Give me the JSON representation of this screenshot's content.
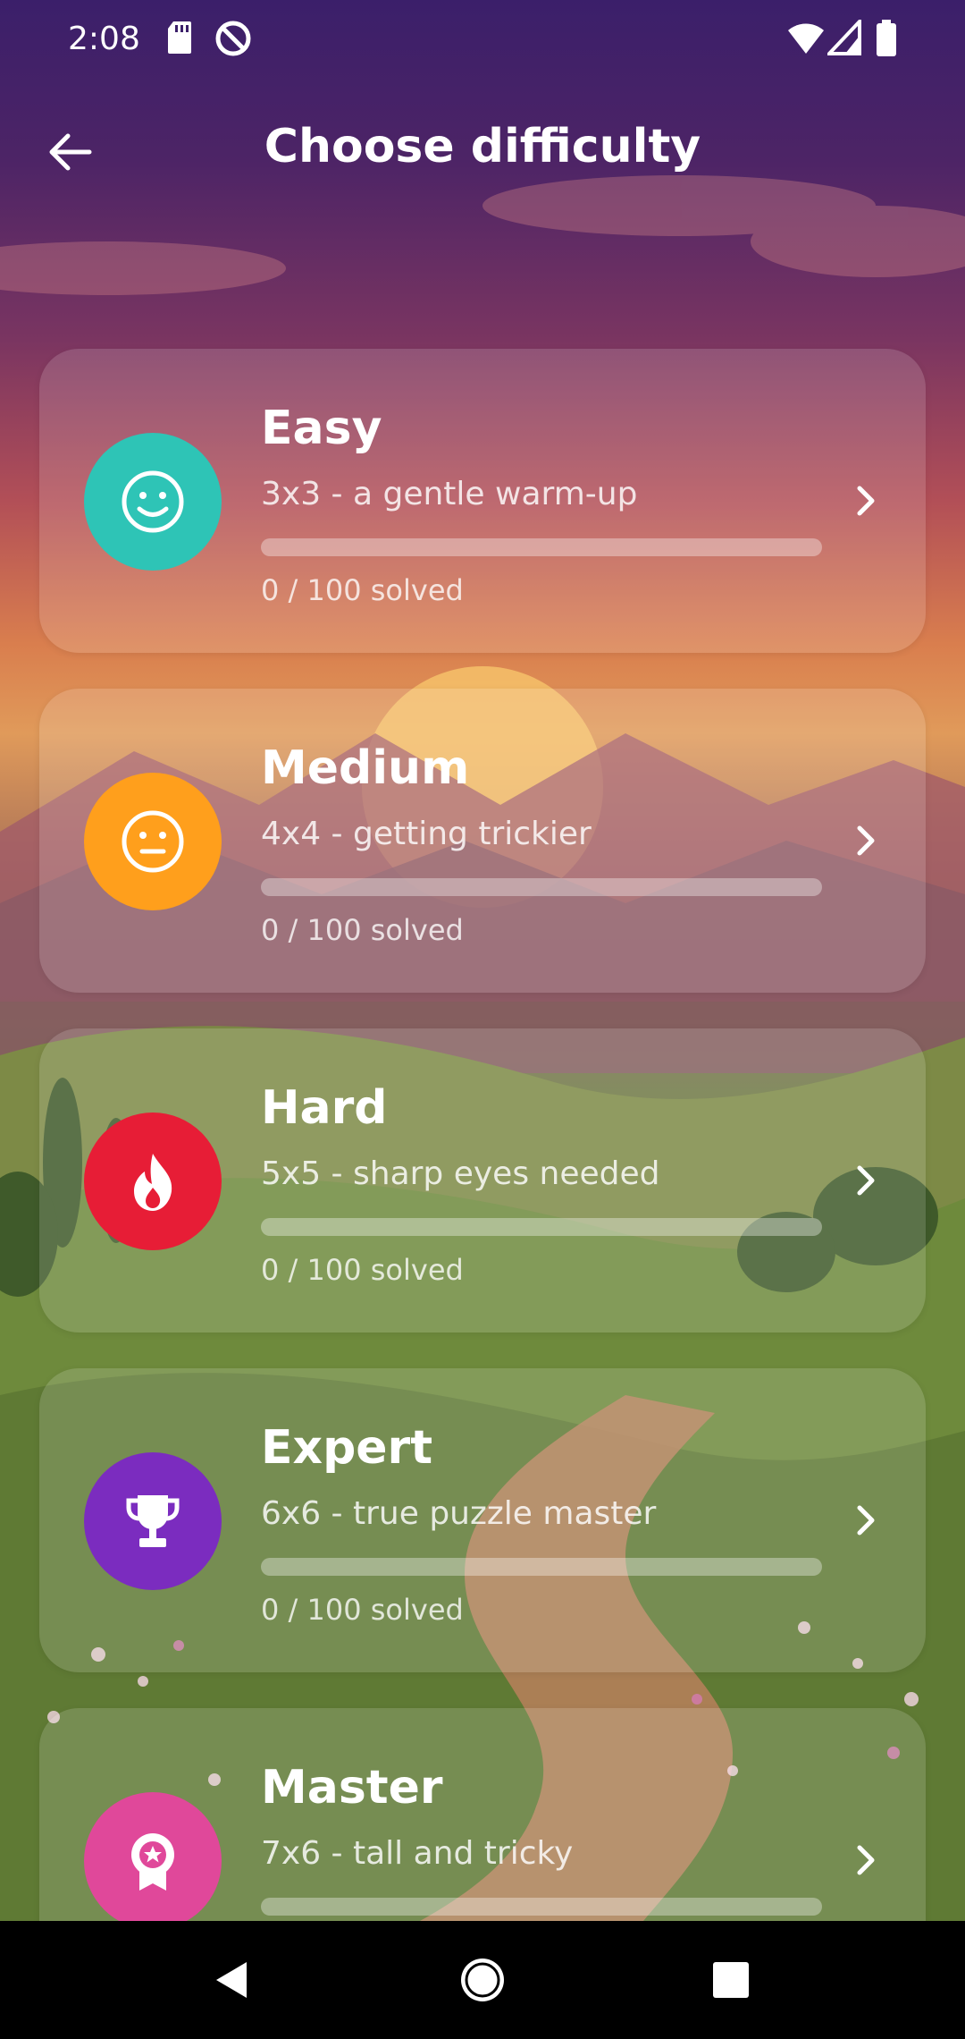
{
  "status_bar": {
    "time": "2:08",
    "icons": [
      "sd-card-icon",
      "do-not-disturb-icon",
      "wifi-icon",
      "signal-icon",
      "battery-icon"
    ]
  },
  "app_bar": {
    "title": "Choose difficulty",
    "back_icon": "arrow-left-icon"
  },
  "levels": [
    {
      "name": "Easy",
      "description": "3x3 - a gentle warm-up",
      "solved_text": "0 / 100 solved",
      "progress": 0,
      "color": "#2ec4b6",
      "icon": "smile-icon"
    },
    {
      "name": "Medium",
      "description": "4x4 - getting trickier",
      "solved_text": "0 / 100 solved",
      "progress": 0,
      "color": "#ff9f1c",
      "icon": "neutral-face-icon"
    },
    {
      "name": "Hard",
      "description": "5x5 - sharp eyes needed",
      "solved_text": "0 / 100 solved",
      "progress": 0,
      "color": "#e71d36",
      "icon": "flame-icon"
    },
    {
      "name": "Expert",
      "description": "6x6 - true puzzle master",
      "solved_text": "0 / 100 solved",
      "progress": 0,
      "color": "#7b2cbf",
      "icon": "trophy-icon"
    },
    {
      "name": "Master",
      "description": "7x6 - tall and tricky",
      "solved_text": "",
      "progress": 0,
      "color": "#e0489a",
      "icon": "award-badge-icon"
    }
  ],
  "nav_bar": {
    "icons": [
      "nav-back-icon",
      "nav-home-icon",
      "nav-recents-icon"
    ]
  }
}
